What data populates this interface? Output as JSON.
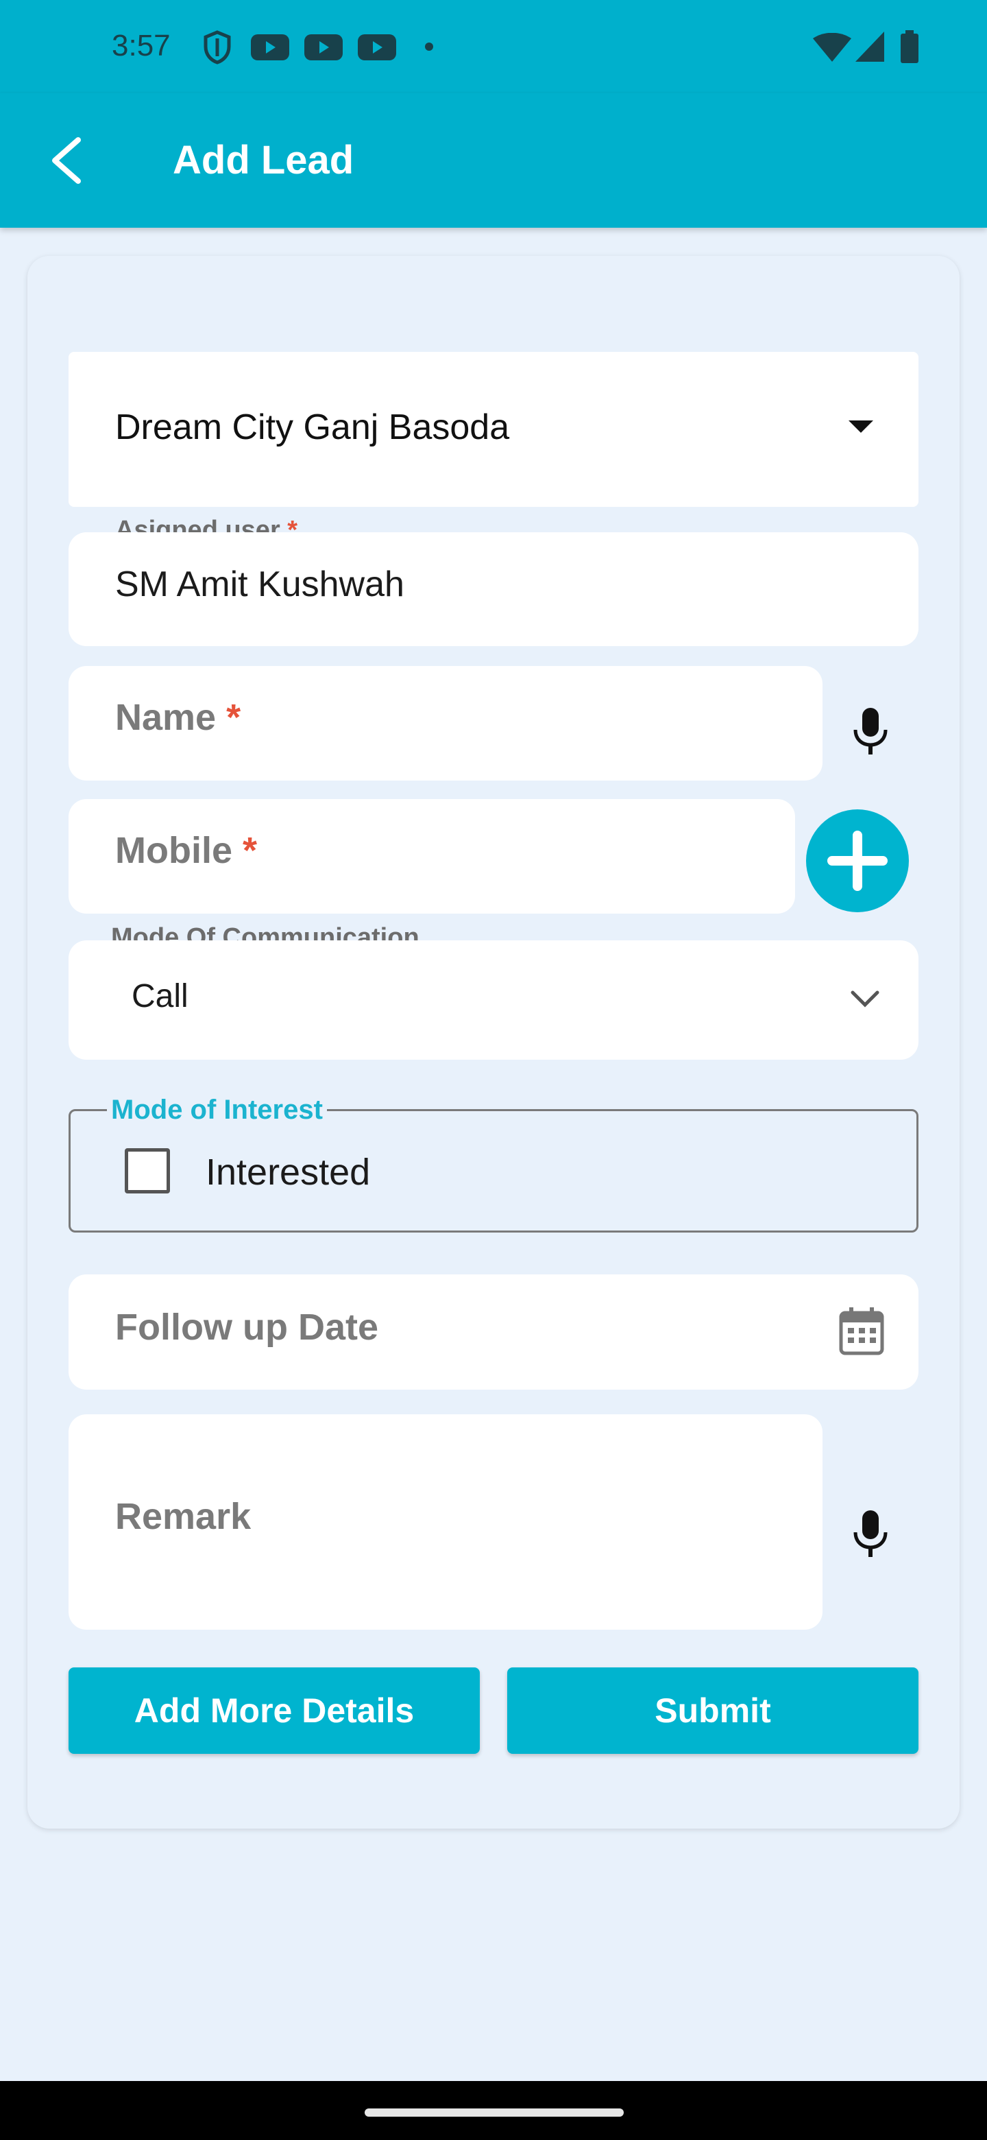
{
  "status_bar": {
    "time": "3:57",
    "icons": [
      "shield-icon",
      "youtube-icon",
      "youtube-icon",
      "youtube-icon",
      "dot-icon",
      "wifi-icon",
      "signal-icon",
      "battery-icon"
    ]
  },
  "app_bar": {
    "title": "Add Lead",
    "back_icon": "arrow-back-icon",
    "color": "#00b0cc"
  },
  "form": {
    "project": {
      "value": "Dream City Ganj Basoda"
    },
    "assigned_user": {
      "label": "Asigned user",
      "required_mark": "*",
      "value": "SM Amit Kushwah"
    },
    "name": {
      "placeholder": "Name",
      "required_mark": "*"
    },
    "mobile": {
      "placeholder": "Mobile",
      "required_mark": "*"
    },
    "mode_of_communication": {
      "label": "Mode Of Communication",
      "value": "Call"
    },
    "mode_of_interest": {
      "legend": "Mode of Interest",
      "checkbox_label": "Interested",
      "checked": false
    },
    "follow_up_date": {
      "placeholder": "Follow up Date"
    },
    "remark": {
      "placeholder": "Remark"
    }
  },
  "buttons": {
    "add_more_details": "Add More Details",
    "submit": "Submit"
  },
  "colors": {
    "accent": "#00b4cf",
    "background": "#e8f1fb",
    "required": "#e5533a",
    "legend_active": "#1bb3cf"
  }
}
